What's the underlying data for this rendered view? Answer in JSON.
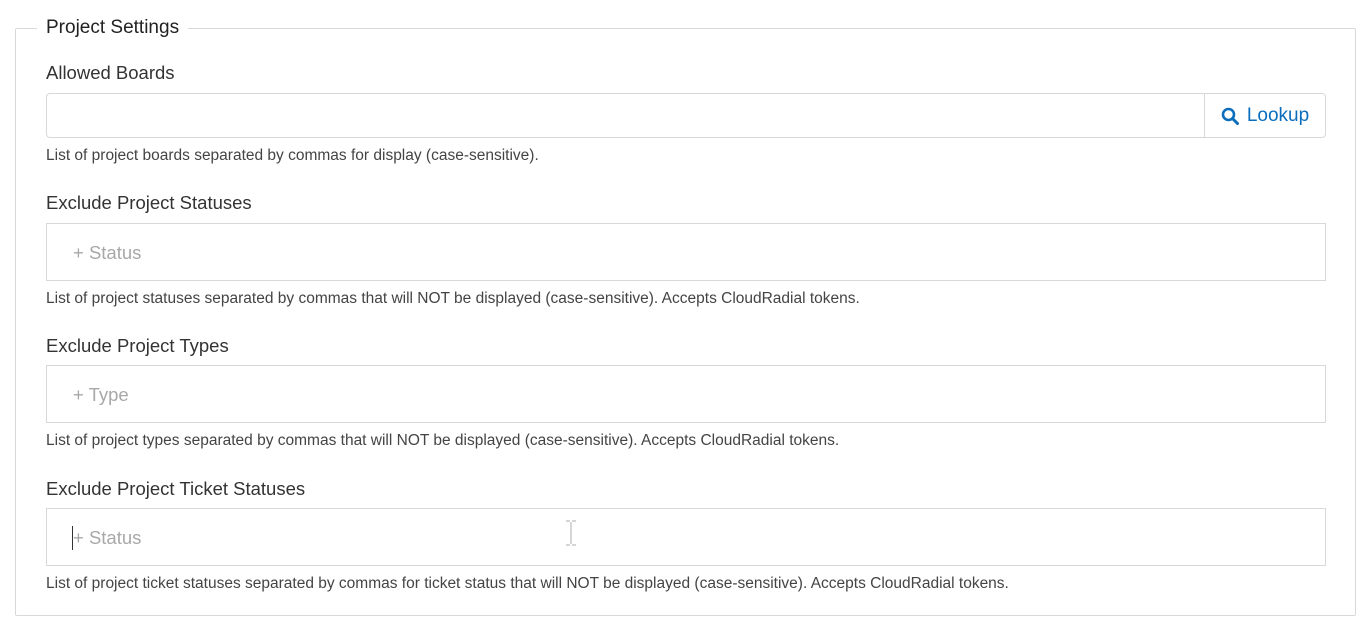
{
  "section": {
    "title": "Project Settings"
  },
  "allowed_boards": {
    "label": "Allowed Boards",
    "value": "",
    "lookup_label": "Lookup",
    "lookup_icon": "search-icon",
    "help": "List of project boards separated by commas for display (case-sensitive)."
  },
  "exclude_project_statuses": {
    "label": "Exclude Project Statuses",
    "placeholder": "+ Status",
    "help": "List of project statuses separated by commas that will NOT be displayed (case-sensitive). Accepts CloudRadial tokens."
  },
  "exclude_project_types": {
    "label": "Exclude Project Types",
    "placeholder": "+ Type",
    "help": "List of project types separated by commas that will NOT be displayed (case-sensitive). Accepts CloudRadial tokens."
  },
  "exclude_project_ticket_statuses": {
    "label": "Exclude Project Ticket Statuses",
    "placeholder": "+ Status",
    "help": "List of project ticket statuses separated by commas for ticket status that will NOT be displayed (case-sensitive). Accepts CloudRadial tokens."
  },
  "colors": {
    "accent": "#0a6ebd",
    "border": "#d8d8d8",
    "placeholder": "#a8a8a8"
  }
}
